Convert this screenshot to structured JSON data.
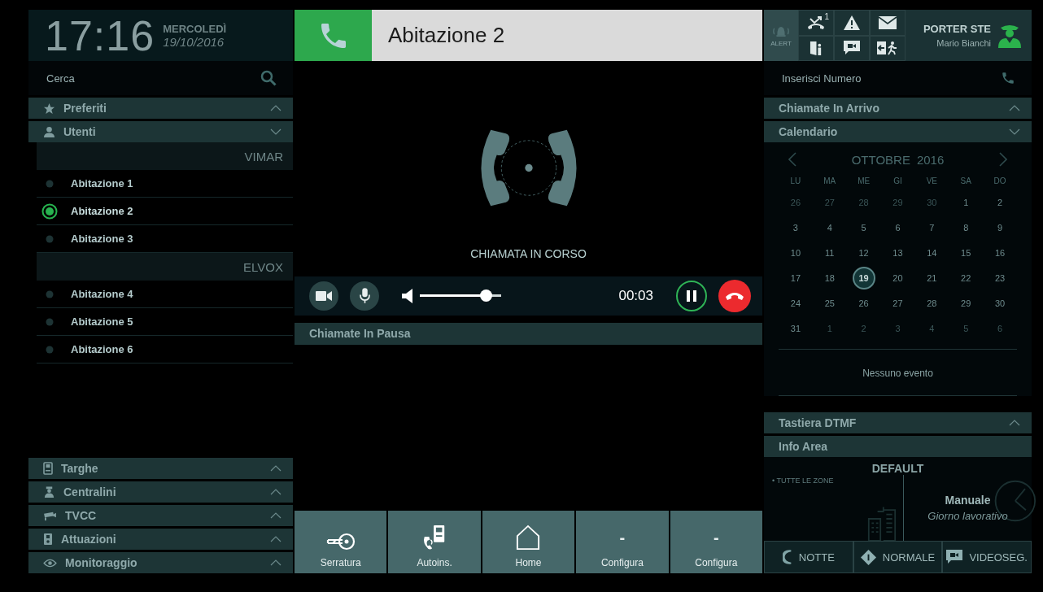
{
  "clock": {
    "time": "17:16",
    "day": "MERCOLEDÌ",
    "date": "19/10/2016"
  },
  "search": {
    "placeholder": "Cerca"
  },
  "sidebar": {
    "top_sections": [
      {
        "label": "Preferiti",
        "expanded": false
      },
      {
        "label": "Utenti",
        "expanded": true
      }
    ],
    "groups": [
      {
        "name": "VIMAR",
        "items": [
          {
            "label": "Abitazione 1",
            "selected": false
          },
          {
            "label": "Abitazione 2",
            "selected": true
          },
          {
            "label": "Abitazione 3",
            "selected": false
          }
        ]
      },
      {
        "name": "ELVOX",
        "items": [
          {
            "label": "Abitazione 4",
            "selected": false
          },
          {
            "label": "Abitazione 5",
            "selected": false
          },
          {
            "label": "Abitazione 6",
            "selected": false
          }
        ]
      }
    ],
    "bottom_sections": [
      {
        "label": "Targhe",
        "expanded": false
      },
      {
        "label": "Centralini",
        "expanded": false
      },
      {
        "label": "TVCC",
        "expanded": false
      },
      {
        "label": "Attuazioni",
        "expanded": false
      },
      {
        "label": "Monitoraggio",
        "expanded": false
      }
    ]
  },
  "call": {
    "name": "Abitazione 2",
    "status": "CHIAMATA IN CORSO",
    "timer": "00:03",
    "volume": {
      "level": 0.75
    },
    "paused_title": "Chiamate In Pausa"
  },
  "quick_buttons": [
    {
      "kind": "key",
      "label": "Serratura"
    },
    {
      "kind": "intercom",
      "label": "Autoins."
    },
    {
      "kind": "home",
      "label": "Home"
    },
    {
      "kind": "dash",
      "symbol": "-",
      "label": "Configura"
    },
    {
      "kind": "dash",
      "symbol": "-",
      "label": "Configura"
    }
  ],
  "status": {
    "alert_label": "ALERT",
    "missed_calls": "1",
    "porter": "PORTER STE",
    "user": "Mario Bianchi"
  },
  "dial": {
    "placeholder": "Inserisci Numero"
  },
  "right_sections": [
    {
      "label": "Chiamate In Arrivo",
      "expanded": false
    },
    {
      "label": "Calendario",
      "expanded": true
    }
  ],
  "calendar": {
    "month": "OTTOBRE",
    "year": "2016",
    "weekdays": [
      "LU",
      "MA",
      "ME",
      "GI",
      "VE",
      "SA",
      "DO"
    ],
    "days": [
      {
        "label": "26",
        "muted": true,
        "selected": false
      },
      {
        "label": "27",
        "muted": true,
        "selected": false
      },
      {
        "label": "28",
        "muted": true,
        "selected": false
      },
      {
        "label": "29",
        "muted": true,
        "selected": false
      },
      {
        "label": "30",
        "muted": true,
        "selected": false
      },
      {
        "label": "1",
        "muted": false,
        "selected": false
      },
      {
        "label": "2",
        "muted": false,
        "selected": false
      },
      {
        "label": "3",
        "muted": false,
        "selected": false
      },
      {
        "label": "4",
        "muted": false,
        "selected": false
      },
      {
        "label": "5",
        "muted": false,
        "selected": false
      },
      {
        "label": "6",
        "muted": false,
        "selected": false
      },
      {
        "label": "7",
        "muted": false,
        "selected": false
      },
      {
        "label": "8",
        "muted": false,
        "selected": false
      },
      {
        "label": "9",
        "muted": false,
        "selected": false
      },
      {
        "label": "10",
        "muted": false,
        "selected": false
      },
      {
        "label": "11",
        "muted": false,
        "selected": false
      },
      {
        "label": "12",
        "muted": false,
        "selected": false
      },
      {
        "label": "13",
        "muted": false,
        "selected": false
      },
      {
        "label": "14",
        "muted": false,
        "selected": false
      },
      {
        "label": "15",
        "muted": false,
        "selected": false
      },
      {
        "label": "16",
        "muted": false,
        "selected": false
      },
      {
        "label": "17",
        "muted": false,
        "selected": false
      },
      {
        "label": "18",
        "muted": false,
        "selected": false
      },
      {
        "label": "19",
        "muted": false,
        "selected": true
      },
      {
        "label": "20",
        "muted": false,
        "selected": false
      },
      {
        "label": "21",
        "muted": false,
        "selected": false
      },
      {
        "label": "22",
        "muted": false,
        "selected": false
      },
      {
        "label": "23",
        "muted": false,
        "selected": false
      },
      {
        "label": "24",
        "muted": false,
        "selected": false
      },
      {
        "label": "25",
        "muted": false,
        "selected": false
      },
      {
        "label": "26",
        "muted": false,
        "selected": false
      },
      {
        "label": "27",
        "muted": false,
        "selected": false
      },
      {
        "label": "28",
        "muted": false,
        "selected": false
      },
      {
        "label": "29",
        "muted": false,
        "selected": false
      },
      {
        "label": "30",
        "muted": false,
        "selected": false
      },
      {
        "label": "31",
        "muted": false,
        "selected": false
      },
      {
        "label": "1",
        "muted": true,
        "selected": false
      },
      {
        "label": "2",
        "muted": true,
        "selected": false
      },
      {
        "label": "3",
        "muted": true,
        "selected": false
      },
      {
        "label": "4",
        "muted": true,
        "selected": false
      },
      {
        "label": "5",
        "muted": true,
        "selected": false
      },
      {
        "label": "6",
        "muted": true,
        "selected": false
      }
    ],
    "events": "Nessuno evento"
  },
  "dtmf": {
    "label": "Tastiera DTMF",
    "expanded": false
  },
  "info": {
    "title": "Info Area",
    "profile": "DEFAULT",
    "zone": "• TUTTE LE ZONE",
    "mode": "Manuale",
    "day_type": "Giorno lavorativo"
  },
  "mode_buttons": [
    {
      "label": "NOTTE"
    },
    {
      "label": "NORMALE"
    },
    {
      "label": "VIDEOSEG."
    }
  ]
}
